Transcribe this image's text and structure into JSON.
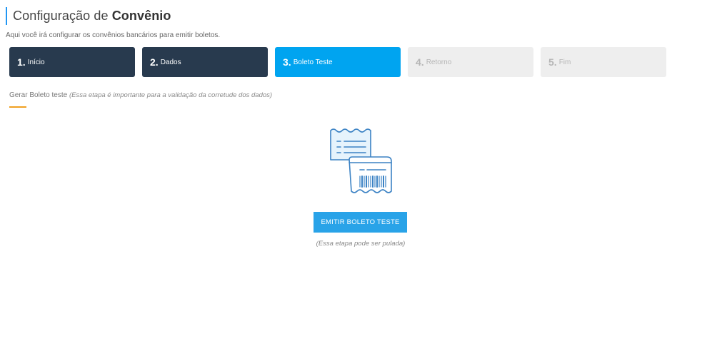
{
  "header": {
    "title_prefix": "Configuração de",
    "title_bold": "Convênio",
    "subtitle": "Aqui você irá configurar os convênios bancários para emitir boletos."
  },
  "steps": [
    {
      "num": "1.",
      "label": "Início",
      "state": "done"
    },
    {
      "num": "2.",
      "label": "Dados",
      "state": "done"
    },
    {
      "num": "3.",
      "label": "Boleto Teste",
      "state": "active"
    },
    {
      "num": "4.",
      "label": "Retorno",
      "state": "todo"
    },
    {
      "num": "5.",
      "label": "Fim",
      "state": "todo"
    }
  ],
  "section": {
    "label": "Gerar Boleto teste",
    "note": "(Essa etapa é importante para a validação da corretude dos dados)"
  },
  "illustration": {
    "icon": "boleto-receipt-icon"
  },
  "action": {
    "button_label": "EMITIR BOLETO TESTE",
    "skip_note": "(Essa etapa pode ser pulada)"
  },
  "colors": {
    "accent": "#2196f3",
    "step_done": "#283a4e",
    "step_active": "#00a4f0",
    "step_todo": "#eeeeee",
    "button": "#29a3e8",
    "underline": "#f0a020"
  }
}
